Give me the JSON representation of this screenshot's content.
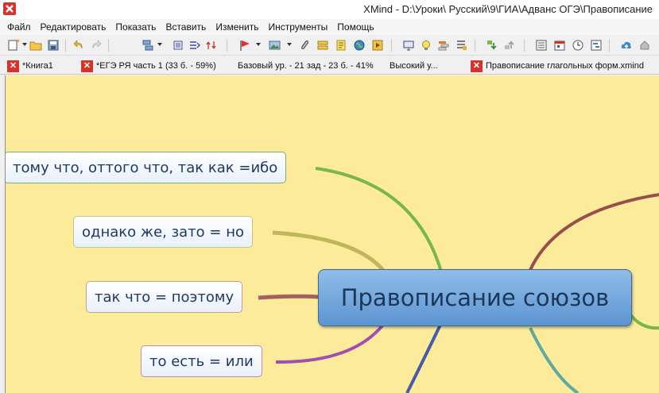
{
  "window": {
    "title": "XMind - D:\\Уроки\\ Русский\\9\\ГИА\\Адванс ОГЭ\\Правописание"
  },
  "menu": [
    "Файл",
    "Редактировать",
    "Показать",
    "Вставить",
    "Изменить",
    "Инструменты",
    "Помощь"
  ],
  "tabs": [
    {
      "label": "*Книга1",
      "has_close": true
    },
    {
      "label": "*ЕГЭ РЯ часть 1 (33 б. - 59%)",
      "has_close": true
    },
    {
      "label": "Базовый ур. - 21 зад - 23 б. - 41%",
      "has_close": false
    },
    {
      "label": "Высокий у...",
      "has_close": false
    },
    {
      "label": "Правописание глагольных форм.xmind",
      "has_close": true
    }
  ],
  "map": {
    "central_topic": "Правописание союзов",
    "topics": [
      {
        "label": "тому что, оттого что, так как =ибо",
        "line_color": "#7ab648"
      },
      {
        "label": "однако же, зато = но",
        "line_color": "#bdb65a"
      },
      {
        "label": "так что = поэтому",
        "line_color": "#a45f5f"
      },
      {
        "label": "то есть = или",
        "line_color": "#a04fb0"
      }
    ]
  },
  "colors": {
    "canvas_background": "#fdeb9c",
    "central_fill": "#6fa3da",
    "central_text": "#1c3758",
    "tab_close": "#d9322b"
  },
  "icons": {
    "app": "xmind-logo-icon",
    "toolbar": [
      "new-icon",
      "open-folder-icon",
      "save-icon",
      "undo-icon",
      "redo-icon",
      "insert-topic-icon",
      "insert-subtopic-icon",
      "relationship-icon",
      "boundary-icon",
      "marker-flag-icon",
      "image-icon",
      "attachment-icon",
      "label-icon",
      "notes-icon",
      "hyperlink-globe-icon",
      "audio-icon",
      "presentation-icon",
      "lightbulb-icon",
      "summary-icon",
      "structure-icon",
      "drill-down-icon",
      "drill-up-icon",
      "outline-icon",
      "calendar-icon",
      "clock-icon",
      "gantt-icon",
      "upload-cloud-icon",
      "share-icon"
    ]
  }
}
